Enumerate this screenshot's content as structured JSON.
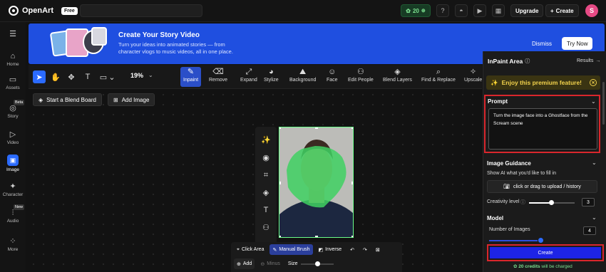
{
  "app": {
    "name": "OpenArt",
    "plan_badge": "Free"
  },
  "topbar": {
    "credits": "20",
    "upgrade": "Upgrade",
    "create": "Create",
    "avatar_letter": "S"
  },
  "sidebar": {
    "items": [
      {
        "label": "Home",
        "icon": "home-icon"
      },
      {
        "label": "Assets",
        "icon": "folder-icon"
      },
      {
        "label": "Story",
        "icon": "story-icon",
        "badge": "Beta"
      },
      {
        "label": "Video",
        "icon": "video-icon"
      },
      {
        "label": "Image",
        "icon": "image-icon"
      },
      {
        "label": "Character",
        "icon": "character-icon"
      },
      {
        "label": "Audio",
        "icon": "audio-icon",
        "badge": "New"
      },
      {
        "label": "More",
        "icon": "more-icon"
      }
    ]
  },
  "banner": {
    "title": "Create Your Story Video",
    "subtitle": "Turn your ideas into animated stories — from character vlogs to music videos, all in one place.",
    "dismiss": "Dismiss",
    "cta": "Try Now"
  },
  "toolbar": {
    "zoom": "19%",
    "functions": [
      "Inpaint",
      "Remove",
      "Expand",
      "Stylize",
      "Background",
      "Face",
      "Edit People",
      "Blend Layers",
      "Find & Replace",
      "Upscale"
    ]
  },
  "canvas": {
    "blend_board": "Start a Blend Board",
    "add_image": "Add Image"
  },
  "brush_bar": {
    "click_area": "Click Area",
    "manual_brush": "Manual Brush",
    "inverse": "Inverse",
    "add": "Add",
    "minus": "Minus",
    "size": "Size"
  },
  "panel": {
    "title": "InPaint Area",
    "results": "Results",
    "premium": "Enjoy this premium feature!",
    "prompt": {
      "title": "Prompt",
      "value": "Turn the image face into a Ghostface from the Scream scene"
    },
    "guidance": {
      "title": "Image Guidance",
      "hint": "Show AI what you'd like to fill in",
      "upload": "click or drag to upload / history",
      "creativity_label": "Creativity level",
      "creativity_value": "3"
    },
    "model": {
      "title": "Model",
      "num_images_label": "Number of Images",
      "num_images_value": "4"
    },
    "create": "Create",
    "charge_count": "20 credits",
    "charge_text": " will be charged"
  },
  "colors": {
    "accent": "#2b6bff",
    "banner": "#1f4fe0",
    "highlight_red": "#d9262c",
    "mask_green": "#3fd161"
  }
}
